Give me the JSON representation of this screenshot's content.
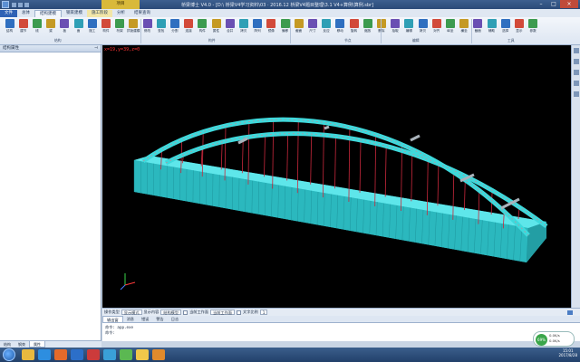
{
  "window": {
    "title": "桥梁博士 V4.0 - [D:\\ 桥梁V4学习资料\\03 · 2016.12 桥梁V4题目整理\\3.1 V4+算例\\算例.sbr]",
    "context_tab": "项目",
    "controls": [
      "–",
      "□",
      "×"
    ]
  },
  "tabs": [
    "文件",
    "总体",
    "结构建模",
    "钢束建模",
    "施工阶段",
    "分析",
    "结果查询"
  ],
  "ribbon": {
    "buttons": [
      "结构",
      "建节",
      "线",
      "梁",
      "板",
      "面",
      "施工",
      "构件",
      "桁架",
      "拱肋建模",
      "修改",
      "查找",
      "分割",
      "连接",
      "构件",
      "属性",
      "合并",
      "拷贝",
      "阵列",
      "镜像",
      "偏移",
      "截面",
      "尺寸",
      "反应",
      "移动",
      "旋转",
      "缩放",
      "删除",
      "拾取",
      "编辑",
      "拷贝",
      "对齐",
      "纵坐",
      "横坐",
      "截面",
      "辅助",
      "选择",
      "显示",
      "参数"
    ],
    "groups": [
      "结构",
      "构件",
      "节点",
      "编辑",
      "工具"
    ]
  },
  "left_panel": {
    "title": "结构属性",
    "bottom_tabs": [
      "结构",
      "钢束",
      "属性"
    ]
  },
  "viewport": {
    "coord_readout": "x=19,y=39,z=0",
    "background": "#000000",
    "deck_color": "#2fd3d3",
    "hanger_color": "#c8283c",
    "arch_color": "#9aa3aa"
  },
  "property_bar": {
    "items": [
      "操作类型",
      "显示模式",
      "显示内容",
      "结构模型",
      "",
      "当前工作面",
      "当前工作面",
      "文字比例",
      "1"
    ]
  },
  "command_tabs": [
    "输出窗",
    "消息",
    "错误",
    "警告",
    "日志"
  ],
  "command_lines": [
    "命令: app.exe",
    "命令:"
  ],
  "taskbar": {
    "time": "15:01",
    "date": "2017/8/28"
  },
  "badge": {
    "percent": "69%",
    "line1": "0.0K/s",
    "line2": "0.0K/s"
  }
}
